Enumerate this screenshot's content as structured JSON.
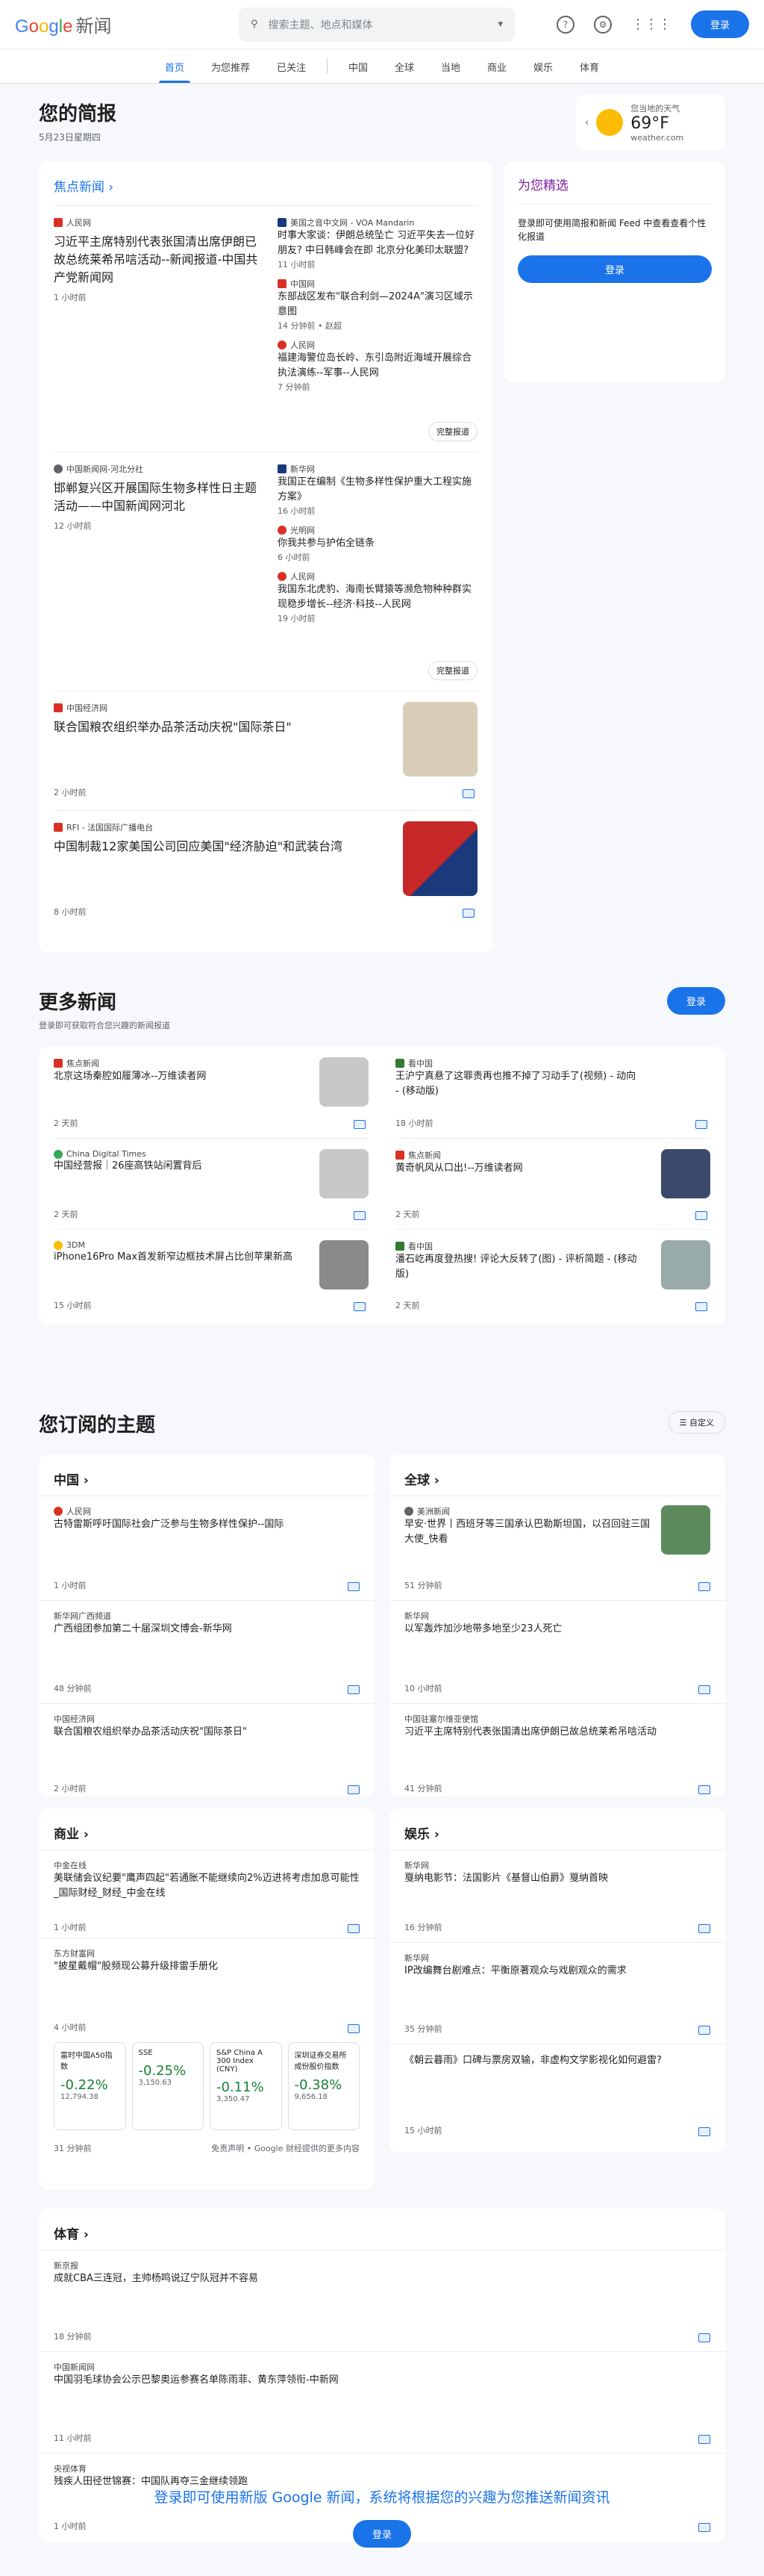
{
  "header": {
    "logo_google": "Google",
    "logo_news": "新闻",
    "search_placeholder": "搜索主题、地点和媒体",
    "login": "登录"
  },
  "nav": [
    "首页",
    "为您推荐",
    "已关注",
    "中国",
    "全球",
    "当地",
    "商业",
    "娱乐",
    "体育"
  ],
  "briefing": {
    "title": "您的简报",
    "date": "5月23日星期四"
  },
  "weather": {
    "label": "您当地的天气",
    "temp": "69°F",
    "source": "weather.com"
  },
  "top": {
    "title": "焦点新闻",
    "clusters": [
      {
        "main": {
          "src": "人民网",
          "title": "习近平主席特别代表张国清出席伊朗已故总统莱希吊唁活动--新闻报道-中国共产党新闻网",
          "time": "1 小时前"
        },
        "side": [
          {
            "src": "美国之音中文网 - VOA Mandarin",
            "title": "时事大家谈：伊朗总统坠亡 习近平失去一位好朋友? 中日韩峰会在即 北京分化美印太联盟?",
            "time": "11 小时前"
          },
          {
            "src": "中国网",
            "title": "东部战区发布\"联合利剑—2024A\"演习区域示意图",
            "time": "14 分钟前 • 赵超"
          },
          {
            "src": "人民网",
            "title": "福建海警位岛长岭、东引岛附近海域开展综合执法演练--军事--人民网",
            "time": "7 分钟前"
          }
        ],
        "full": "完整报道"
      },
      {
        "main": {
          "src": "中国新闻网-河北分社",
          "title": "邯郸复兴区开展国际生物多样性日主题活动——中国新闻网河北",
          "time": "12 小时前"
        },
        "side": [
          {
            "src": "新华网",
            "title": "我国正在编制《生物多样性保护重大工程实施方案》",
            "time": "16 小时前"
          },
          {
            "src": "光明网",
            "title": "你我共参与护佑全链条",
            "time": "6 小时前"
          },
          {
            "src": "人民网",
            "title": "我国东北虎豹、海南长臂猿等濒危物种种群实现稳步增长--经济·科技--人民网",
            "time": "19 小时前"
          }
        ],
        "full": "完整报道"
      }
    ],
    "singles": [
      {
        "src": "中国经济网",
        "title": "联合国粮农组织举办品茶活动庆祝\"国际茶日\"",
        "time": "2 小时前"
      },
      {
        "src": "RFI - 法国国际广播电台",
        "title": "中国制裁12家美国公司回应美国\"经济胁迫\"和武装台湾",
        "time": "8 小时前"
      }
    ]
  },
  "picks": {
    "title": "为您精选",
    "text": "登录即可使用简报和新闻 Feed 中查看查看个性化报道",
    "btn": "登录"
  },
  "more_news": {
    "title": "更多新闻",
    "sub": "登录即可获取符合您兴趣的新闻报道",
    "btn": "登录",
    "items": [
      {
        "src": "焦点新闻",
        "title": "北京这场秦腔如履薄冰--万维读者网",
        "time": "2 天前"
      },
      {
        "src": "看中国",
        "title": "王沪宁真悬了这罪责再也推不掉了习动手了(视频) - 动向 - (移动版)",
        "time": "18 小时前"
      },
      {
        "src": "China Digital Times",
        "title": "中国经营报｜26座高铁站闲置背后",
        "time": "2 天前"
      },
      {
        "src": "焦点新闻",
        "title": "黄奇帆风从口出!--万维读者网",
        "time": "2 天前"
      },
      {
        "src": "3DM",
        "title": "iPhone16Pro Max首发新窄边框技术屏占比创苹果新高",
        "time": "15 小时前"
      },
      {
        "src": "看中国",
        "title": "潘石屹再度登热搜! 评论大反转了(图) - 评析简题 - (移动版)",
        "time": "2 天前"
      }
    ]
  },
  "subs": {
    "title": "您订阅的主题",
    "custom": "自定义",
    "china": {
      "title": "中国",
      "items": [
        {
          "src": "人民网",
          "title": "古特雷斯呼吁国际社会广泛参与生物多样性保护--国际",
          "time": "1 小时前"
        },
        {
          "src": "新华网广西频道",
          "title": "广西组团参加第二十届深圳文博会-新华网",
          "time": "48 分钟前"
        },
        {
          "src": "中国经济网",
          "title": "联合国粮农组织举办品茶活动庆祝\"国际茶日\"",
          "time": "2 小时前"
        }
      ]
    },
    "global": {
      "title": "全球",
      "items": [
        {
          "src": "美洲新闻",
          "title": "早安·世界丨西班牙等三国承认巴勒斯坦国，以召回驻三国大使_快看",
          "time": "51 分钟前"
        },
        {
          "src": "新华网",
          "title": "以军轰炸加沙地带多地至少23人死亡",
          "time": "10 小时前"
        },
        {
          "src": "中国驻塞尔维亚使馆",
          "title": "习近平主席特别代表张国清出席伊朗已故总统莱希吊唁活动",
          "time": "41 分钟前"
        }
      ]
    },
    "biz": {
      "title": "商业",
      "items": [
        {
          "src": "中金在线",
          "title": "美联储会议纪要\"鹰声四起\"若通胀不能继续向2%迈进将考虑加息可能性_国际财经_财经_中金在线",
          "time": "1 小时前"
        },
        {
          "src": "东方财富网",
          "title": "\"披星戴帽\"股频现公募升级排雷手册化",
          "time": "4 小时前"
        }
      ],
      "stocks": [
        {
          "name": "富时中国A50指数",
          "chg": "-0.22%",
          "val": "12,794.38"
        },
        {
          "name": "SSE",
          "chg": "-0.25%",
          "val": "3,150.63"
        },
        {
          "name": "S&P China A 300 Index (CNY)",
          "chg": "-0.11%",
          "val": "3,350.47"
        },
        {
          "name": "深圳证券交易所成份股价指数",
          "chg": "-0.38%",
          "val": "9,656.18"
        }
      ],
      "time": "31 分钟前",
      "disc": "免责声明 • Google 财经提供的更多内容"
    },
    "ent": {
      "title": "娱乐",
      "items": [
        {
          "src": "新华网",
          "title": "戛纳电影节：法国影片《基督山伯爵》戛纳首映",
          "time": "16 分钟前"
        },
        {
          "src": "新华网",
          "title": "IP改编舞台剧难点：平衡原著观众与戏剧观众的需求",
          "time": "35 分钟前"
        },
        {
          "src": "",
          "title": "《朝云暮雨》口碑与票房双输，非虚构文学影视化如何避雷?",
          "time": "15 小时前"
        }
      ]
    },
    "sport": {
      "title": "体育",
      "items": [
        {
          "src": "新京报",
          "title": "成就CBA三连冠，主帅杨鸣说辽宁队冠并不容易",
          "time": "18 分钟前"
        },
        {
          "src": "中国新闻网",
          "title": "中国羽毛球协会公示巴黎奥运参赛名单陈雨菲、黄东萍领衔-中新网",
          "time": "11 小时前"
        },
        {
          "src": "央视体育",
          "title": "残疾人田径世锦赛：中国队再夺三金继续领跑",
          "time": "1 小时前"
        }
      ]
    }
  },
  "footer": {
    "text": "登录即可使用新版 Google 新闻，系统将根据您的兴趣为您推送新闻资讯",
    "btn": "登录"
  }
}
